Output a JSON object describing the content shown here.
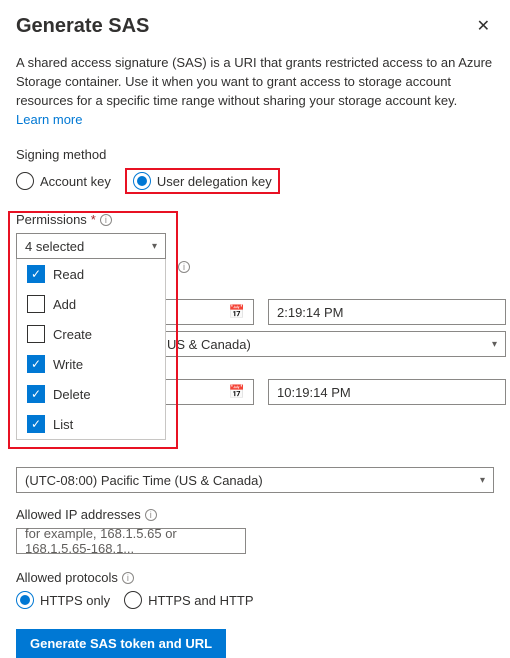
{
  "header": {
    "title": "Generate SAS"
  },
  "description": {
    "text": "A shared access signature (SAS) is a URI that grants restricted access to an Azure Storage container. Use it when you want to grant access to storage account resources for a specific time range without sharing your storage account key. ",
    "learn_more": "Learn more"
  },
  "signing": {
    "label": "Signing method",
    "options": [
      {
        "label": "Account key",
        "selected": false
      },
      {
        "label": "User delegation key",
        "selected": true
      }
    ]
  },
  "permissions": {
    "label": "Permissions",
    "required_mark": "*",
    "summary": "4 selected",
    "options": [
      {
        "label": "Read",
        "checked": true
      },
      {
        "label": "Add",
        "checked": false
      },
      {
        "label": "Create",
        "checked": false
      },
      {
        "label": "Write",
        "checked": true
      },
      {
        "label": "Delete",
        "checked": true
      },
      {
        "label": "List",
        "checked": true
      }
    ]
  },
  "start_time": "2:19:14 PM",
  "expiry_time": "10:19:14 PM",
  "timezone_partial": "US & Canada)",
  "timezone_full": "(UTC-08:00) Pacific Time (US & Canada)",
  "allowed_ip": {
    "label": "Allowed IP addresses",
    "placeholder": "for example, 168.1.5.65 or 168.1.5.65-168.1..."
  },
  "protocols": {
    "label": "Allowed protocols",
    "options": [
      {
        "label": "HTTPS only",
        "selected": true
      },
      {
        "label": "HTTPS and HTTP",
        "selected": false
      }
    ]
  },
  "generate_button": "Generate SAS token and URL"
}
